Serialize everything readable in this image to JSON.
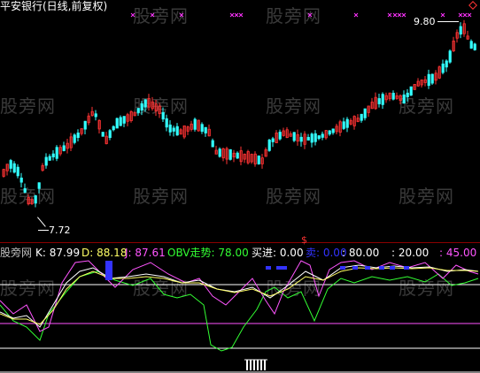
{
  "top_panel": {
    "title": "平安银行(日线,前复权)",
    "high_price_label": "9.80",
    "low_price_label": "7.72"
  },
  "indicator_panel": {
    "items": [
      {
        "text": "股旁网",
        "color": "#c0c0c0"
      },
      {
        "text": "K: 87.99",
        "color": "#ffffff"
      },
      {
        "text": "D: 88.18",
        "color": "#ffff66"
      },
      {
        "text": "J: 87.61",
        "color": "#ff55ff"
      },
      {
        "text": "OBV走势: 78.00",
        "color": "#33ff33"
      },
      {
        "text": "买进: 0.00",
        "color": "#ffffff"
      },
      {
        "text": "卖: 0.00",
        "color": "#3333ff"
      },
      {
        "text": ": 80.00",
        "color": "#ffffff"
      },
      {
        "text": ": 20.00",
        "color": "#ffffff"
      },
      {
        "text": ": 45.00",
        "color": "#ff55ff"
      }
    ]
  },
  "watermark": "股旁网",
  "colors": {
    "up": "#ff3333",
    "down": "#33ffff",
    "divider": "#8b0000",
    "k_line": "#ffffff",
    "d_line": "#ffff66",
    "j_line": "#ff55ff",
    "obv_line": "#33ff33"
  }
}
